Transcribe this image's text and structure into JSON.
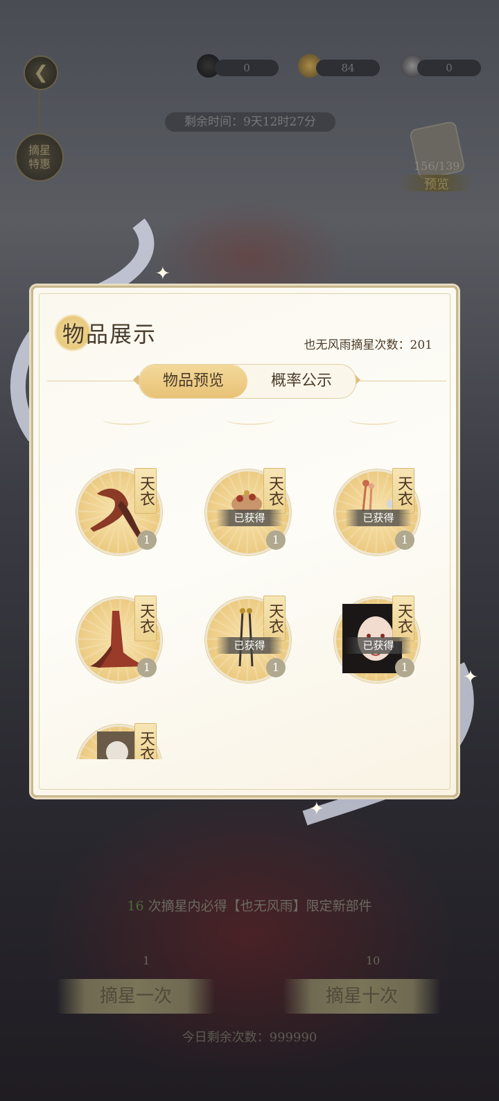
{
  "top_bar": {
    "currencies": [
      {
        "icon": "moon-gem-icon",
        "value": "0",
        "color": "#222222"
      },
      {
        "icon": "gold-coin-icon",
        "value": "84",
        "color": "#b08a3a"
      },
      {
        "icon": "white-pearl-icon",
        "value": "0",
        "color": "#9a9a9a"
      }
    ],
    "timer": "剩余时间：9天12时27分",
    "special_offer": "摘星特惠",
    "preview_count": "156/139",
    "preview_label": "预览"
  },
  "modal": {
    "title": "物品展示",
    "draw_count": "也无风雨摘星次数：201",
    "tabs": [
      {
        "label": "物品预览",
        "active": true
      },
      {
        "label": "概率公示",
        "active": false
      }
    ],
    "items": [
      {
        "tag": "天衣",
        "qty": "1",
        "owned": false,
        "owned_label": "",
        "kind": "scarf"
      },
      {
        "tag": "天衣",
        "qty": "1",
        "owned": true,
        "owned_label": "已获得",
        "kind": "headdress"
      },
      {
        "tag": "天衣",
        "qty": "1",
        "owned": true,
        "owned_label": "已获得",
        "kind": "flowers"
      },
      {
        "tag": "天衣",
        "qty": "1",
        "owned": false,
        "owned_label": "",
        "kind": "skirt"
      },
      {
        "tag": "天衣",
        "qty": "1",
        "owned": true,
        "owned_label": "已获得",
        "kind": "hairpin"
      },
      {
        "tag": "天衣",
        "qty": "1",
        "owned": true,
        "owned_label": "已获得",
        "kind": "face"
      },
      {
        "tag": "天衣",
        "qty": "",
        "owned": false,
        "owned_label": "",
        "kind": "portrait"
      }
    ]
  },
  "bottom": {
    "guarantee_num": "16",
    "guarantee_text": " 次摘星内必得【也无风雨】限定新部件",
    "draw_one_cost": "1",
    "draw_one": "摘星一次",
    "draw_ten_cost": "10",
    "draw_ten": "摘星十次",
    "daily_remaining": "今日剩余次数：999990"
  }
}
